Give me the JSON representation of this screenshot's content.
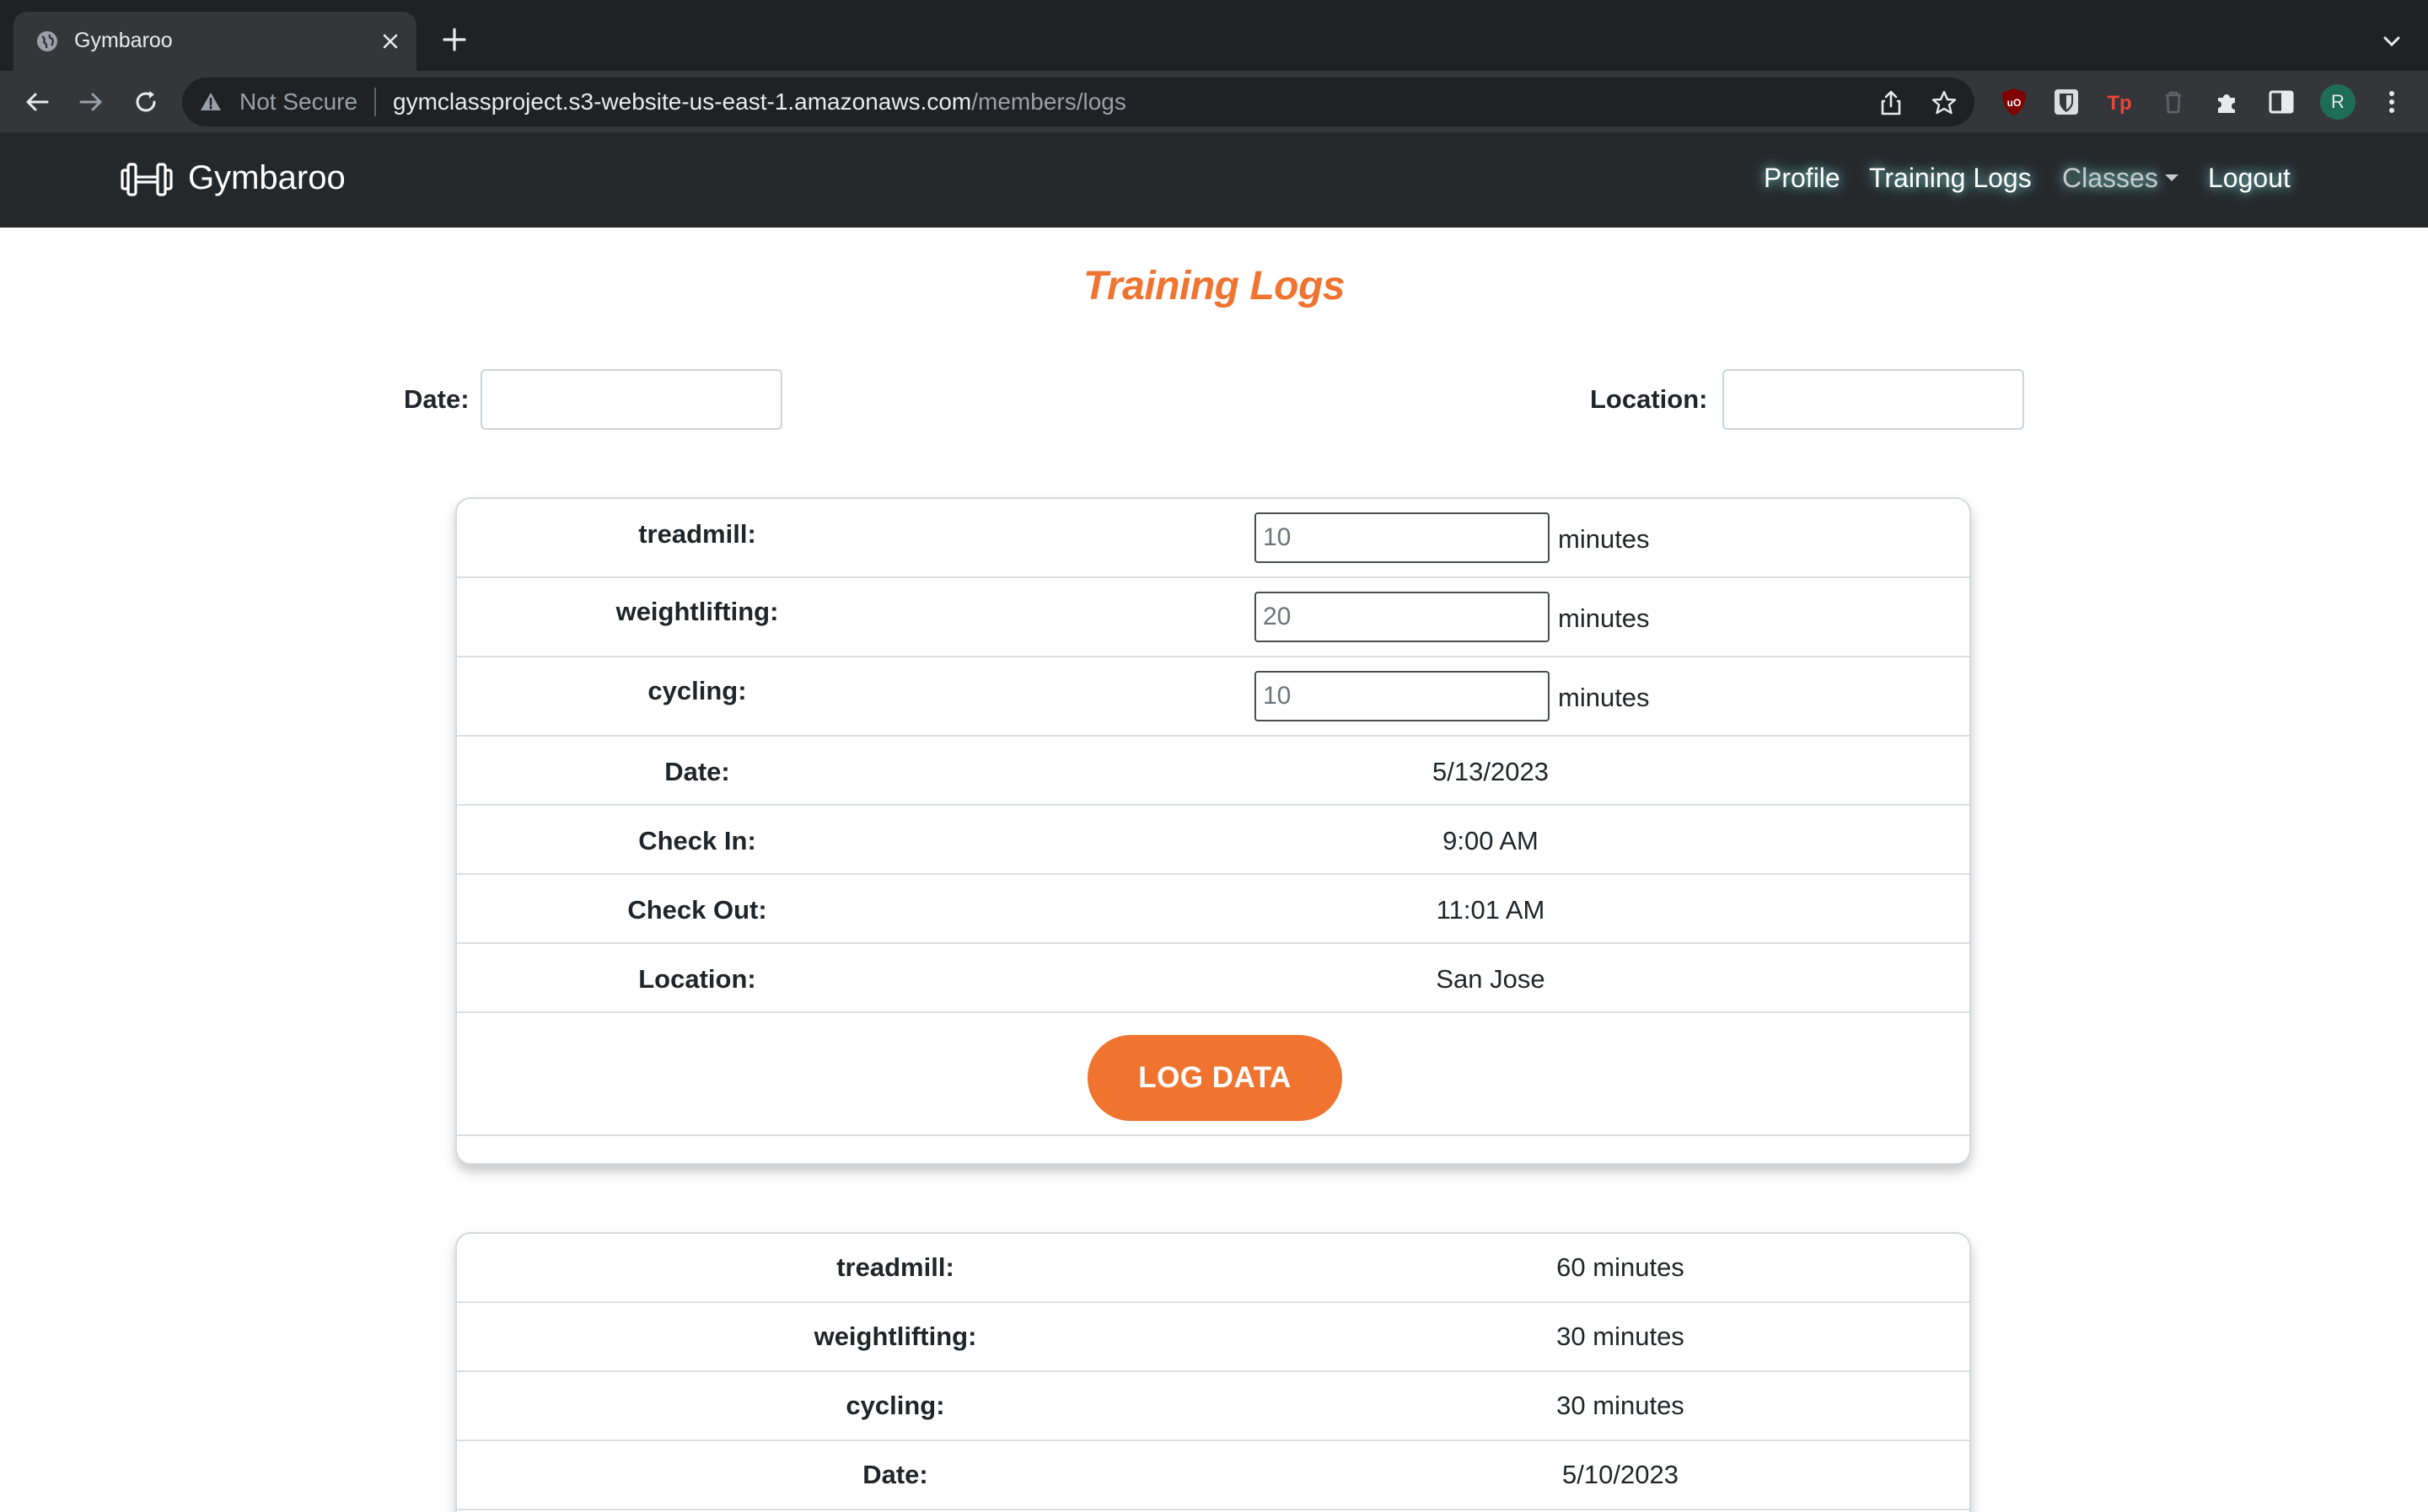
{
  "browser": {
    "tab_title": "Gymbaroo",
    "security_label": "Not Secure",
    "url_host": "gymclassproject.s3-website-us-east-1.amazonaws.com",
    "url_path": "/members/logs",
    "profile_initial": "R"
  },
  "navbar": {
    "brand": "Gymbaroo",
    "links": {
      "profile": "Profile",
      "training_logs": "Training Logs",
      "classes": "Classes",
      "logout": "Logout"
    }
  },
  "page": {
    "title": "Training Logs"
  },
  "filters": {
    "date_label": "Date:",
    "date_value": "",
    "location_label": "Location:",
    "location_value": ""
  },
  "new_log": {
    "treadmill_label": "treadmill:",
    "treadmill_value": "10",
    "weightlifting_label": "weightlifting:",
    "weightlifting_value": "20",
    "cycling_label": "cycling:",
    "cycling_value": "10",
    "unit": "minutes",
    "date_label": "Date:",
    "date_value": "5/13/2023",
    "check_in_label": "Check In:",
    "check_in_value": "9:00 AM",
    "check_out_label": "Check Out:",
    "check_out_value": "11:01 AM",
    "location_label": "Location:",
    "location_value": "San Jose",
    "button_label": "LOG DATA"
  },
  "past_log": {
    "treadmill_label": "treadmill:",
    "treadmill_value": "60 minutes",
    "weightlifting_label": "weightlifting:",
    "weightlifting_value": "30 minutes",
    "cycling_label": "cycling:",
    "cycling_value": "30 minutes",
    "date_label": "Date:",
    "date_value": "5/10/2023"
  },
  "colors": {
    "accent": "#f07430",
    "navbar_bg": "#25282b",
    "browser_bg": "#202124"
  }
}
